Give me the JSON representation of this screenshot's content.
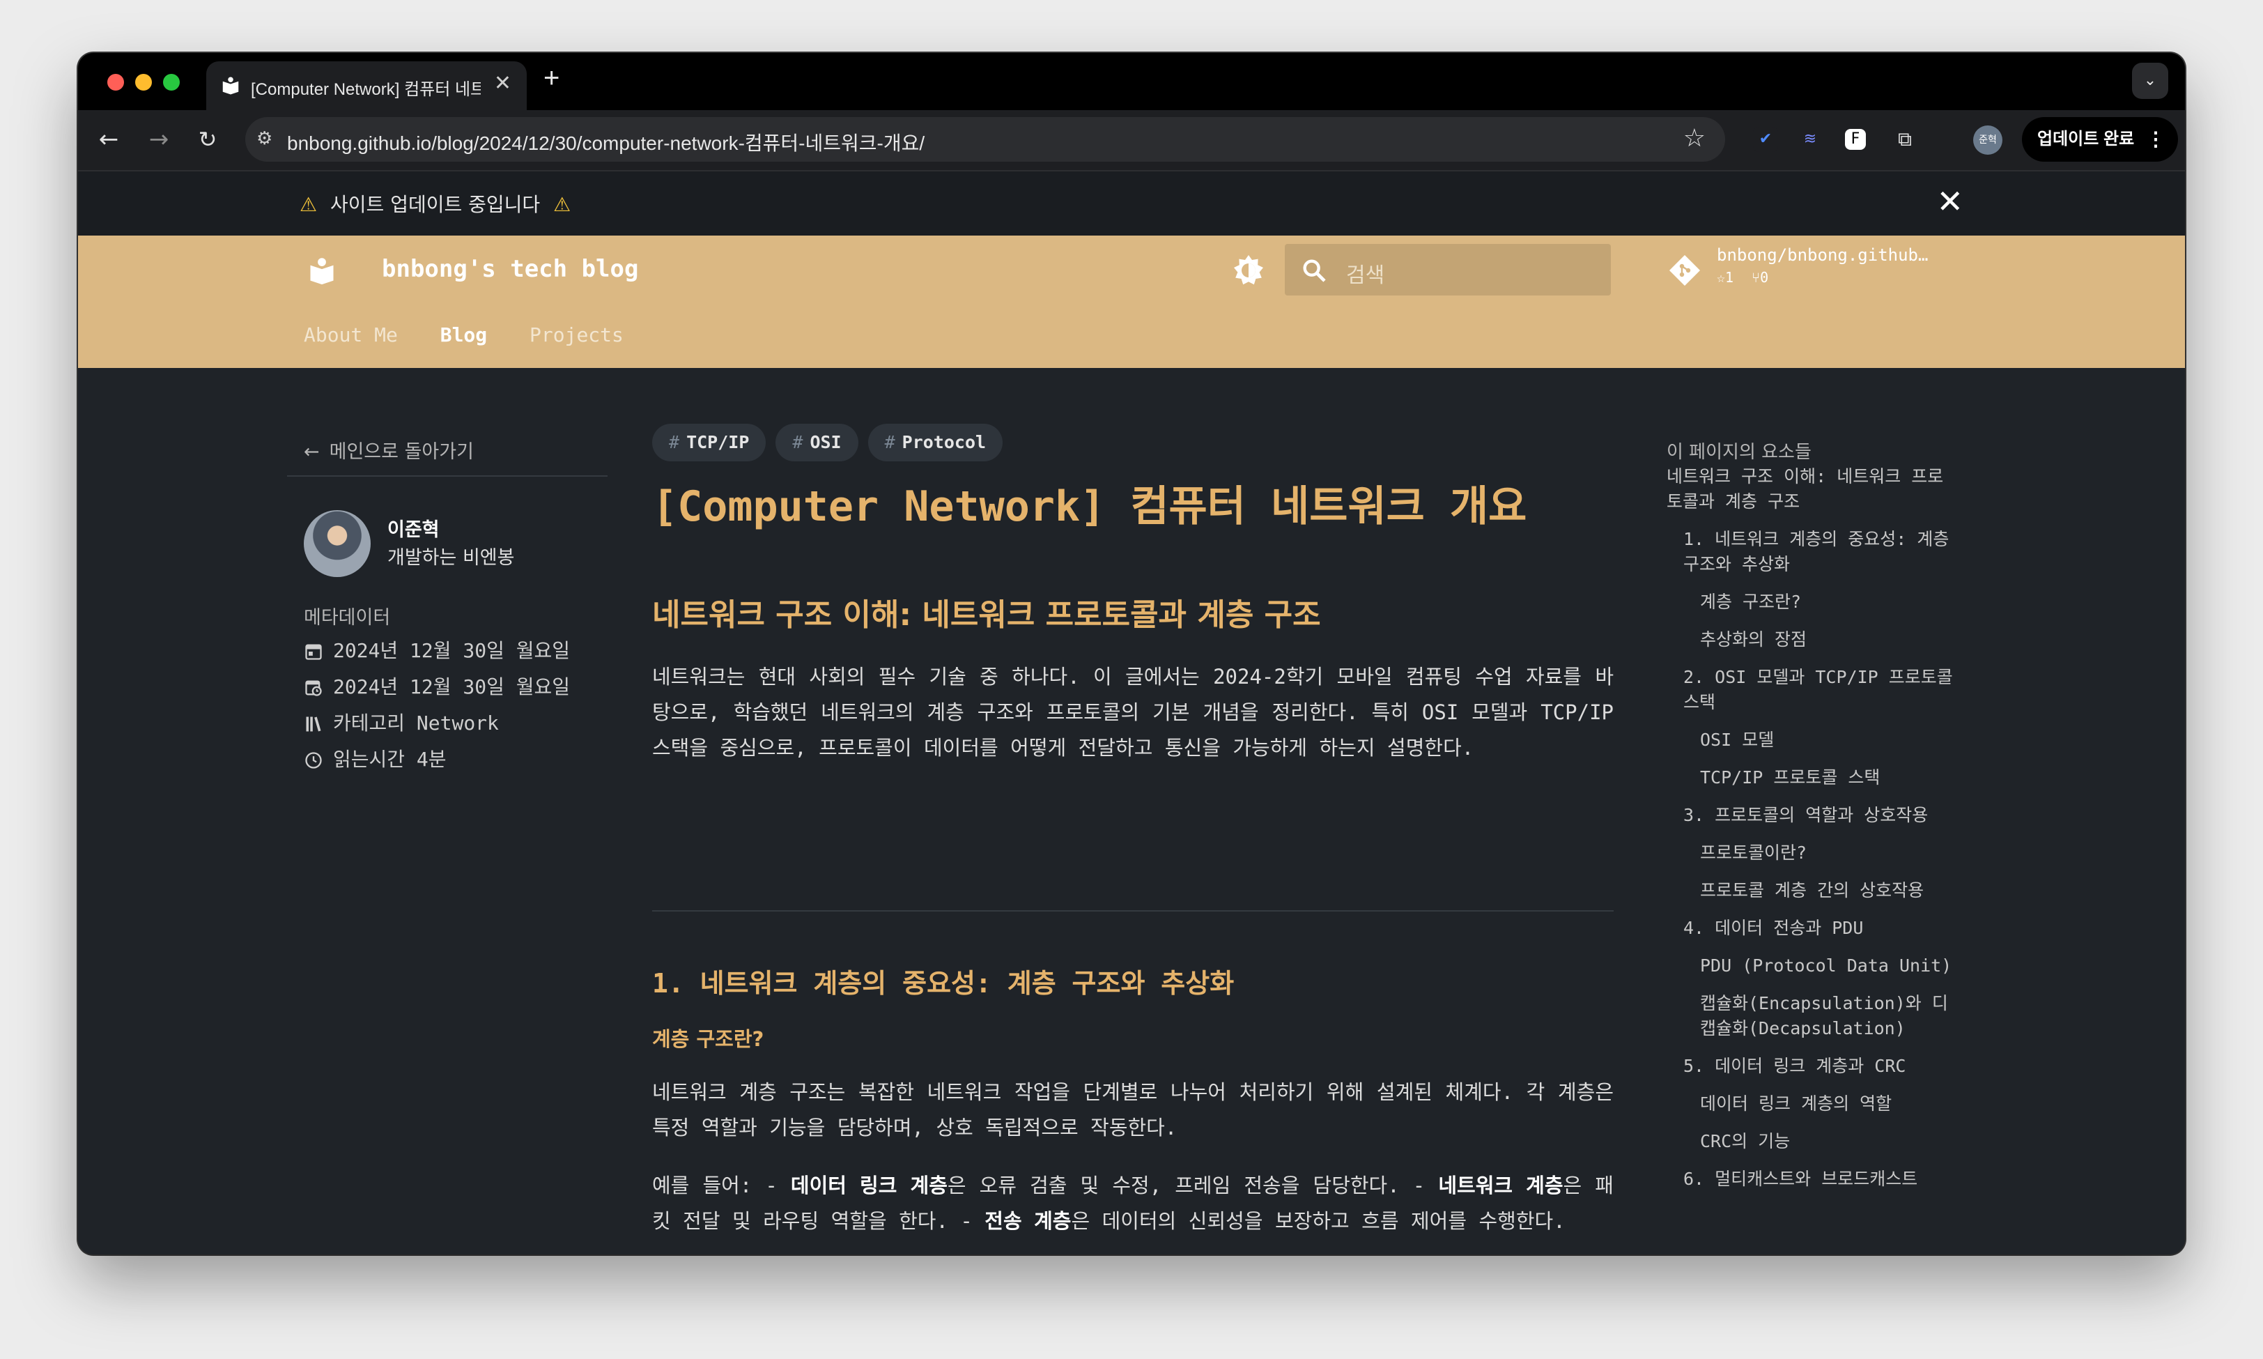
{
  "browser": {
    "tab_title": "[Computer Network] 컴퓨터 네트워크 개요",
    "url": "bnbong.github.io/blog/2024/12/30/computer-network-컴퓨터-네트워크-개요/",
    "update_label": "업데이트 완료",
    "profile_label": "준혁"
  },
  "banner": {
    "message": "사이트 업데이트 중입니다"
  },
  "header": {
    "site_title": "bnbong's tech blog",
    "search_placeholder": "검색",
    "repo_name": "bnbong/bnbong.github…",
    "repo_stars": "1",
    "repo_forks": "0",
    "nav": [
      "About Me",
      "Blog",
      "Projects"
    ]
  },
  "sidebar": {
    "back_label": "메인으로 돌아가기",
    "author_name": "이준혁",
    "author_bio": "개발하는 비엔봉",
    "meta_title": "메타데이터",
    "created": "2024년 12월 30일 월요일",
    "updated": "2024년 12월 30일 월요일",
    "category": "카테고리 Network",
    "reading_time": "읽는시간 4분"
  },
  "article": {
    "tags": [
      "TCP/IP",
      "OSI",
      "Protocol"
    ],
    "title": "[Computer Network] 컴퓨터 네트워크 개요",
    "h2": "네트워크 구조 이해: 네트워크 프로토콜과 계층 구조",
    "intro": "네트워크는 현대 사회의 필수 기술 중 하나다. 이 글에서는 2024-2학기 모바일 컴퓨팅 수업 자료를 바탕으로, 학습했던 네트워크의 계층 구조와 프로토콜의 기본 개념을 정리한다. 특히 OSI 모델과 TCP/IP 스택을 중심으로, 프로토콜이 데이터를 어떻게 전달하고 통신을 가능하게 하는지 설명한다.",
    "h3": "1. 네트워크 계층의 중요성: 계층 구조와 추상화",
    "h4": "계층 구조란?",
    "para2": "네트워크 계층 구조는 복잡한 네트워크 작업을 단계별로 나누어 처리하기 위해 설계된 체계다. 각 계층은 특정 역할과 기능을 담당하며, 상호 독립적으로 작동한다.",
    "para3": {
      "prefix": "예를 들어: - ",
      "b1": "데이터 링크 계층",
      "t1": "은 오류 검출 및 수정, 프레임 전송을 담당한다. - ",
      "b2": "네트워크 계층",
      "t2": "은 패킷 전달 및 라우팅 역할을 한다. - ",
      "b3": "전송 계층",
      "t3": "은 데이터의 신뢰성을 보장하고 흐름 제어를 수행한다."
    }
  },
  "toc": {
    "title": "이 페이지의 요소들",
    "items": [
      {
        "level": 1,
        "label": "네트워크 구조 이해: 네트워크 프로토콜과 계층 구조"
      },
      {
        "level": 2,
        "label": "1. 네트워크 계층의 중요성: 계층 구조와 추상화"
      },
      {
        "level": 3,
        "label": "계층 구조란?"
      },
      {
        "level": 3,
        "label": "추상화의 장점"
      },
      {
        "level": 2,
        "label": "2. OSI 모델과 TCP/IP 프로토콜 스택"
      },
      {
        "level": 3,
        "label": "OSI 모델"
      },
      {
        "level": 3,
        "label": "TCP/IP 프로토콜 스택"
      },
      {
        "level": 2,
        "label": "3. 프로토콜의 역할과 상호작용"
      },
      {
        "level": 3,
        "label": "프로토콜이란?"
      },
      {
        "level": 3,
        "label": "프로토콜 계층 간의 상호작용"
      },
      {
        "level": 2,
        "label": "4. 데이터 전송과 PDU"
      },
      {
        "level": 3,
        "label": "PDU (Protocol Data Unit)"
      },
      {
        "level": 3,
        "label": "캡슐화(Encapsulation)와 디캡슐화(Decapsulation)"
      },
      {
        "level": 2,
        "label": "5. 데이터 링크 계층과 CRC"
      },
      {
        "level": 3,
        "label": "데이터 링크 계층의 역할"
      },
      {
        "level": 3,
        "label": "CRC의 기능"
      },
      {
        "level": 2,
        "label": "6. 멀티캐스트와 브로드캐스트"
      }
    ]
  },
  "colors": {
    "accent": "#e5b36b",
    "header_bg": "#dbb883",
    "page_bg": "#1f2328"
  }
}
